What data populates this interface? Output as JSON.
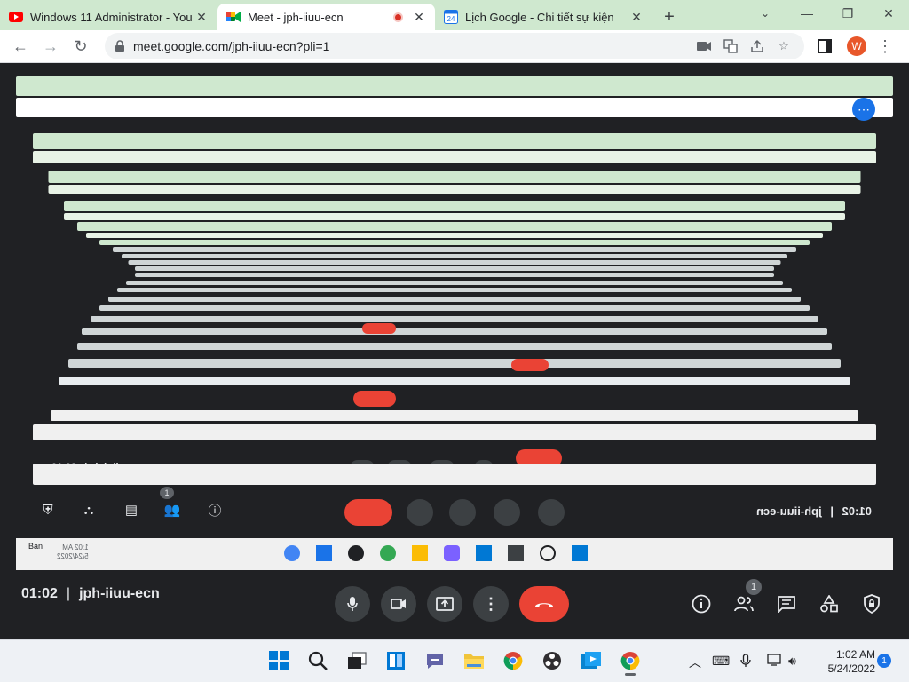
{
  "browser": {
    "tabs": [
      {
        "title": "Windows 11 Administrator - You",
        "icon": "youtube-icon",
        "active": false
      },
      {
        "title": "Meet - jph-iiuu-ecn",
        "icon": "google-meet-icon",
        "active": true
      },
      {
        "title": "Lịch Google - Chi tiết sự kiện",
        "icon": "google-calendar-icon",
        "calendar_day": "24",
        "active": false
      }
    ],
    "new_tab_label": "+",
    "url": "meet.google.com/jph-iiuu-ecn?pli=1",
    "profile_initial": "W",
    "colors": {
      "tab_strip": "#cfe8cf",
      "profile": "#e8572a",
      "record": "#d93025"
    }
  },
  "meeting": {
    "time": "01:02",
    "code": "jph-iiuu-ecn",
    "participants_badge": "1",
    "colors": {
      "end_call": "#ea4335",
      "button_bg": "#3c4043",
      "bg": "#202124"
    }
  },
  "shared_screen": {
    "description_icons": [
      "info-icon",
      "people-icon",
      "chat-icon",
      "activities-icon",
      "host-controls-icon"
    ],
    "time": "01:02",
    "code": "jph-iiuu-ecn",
    "badge": "1",
    "taskbar_corner": "Bạn",
    "taskbar_clock": "1:02 AM",
    "taskbar_date": "5/24/2022"
  },
  "taskbar": {
    "clock_time": "1:02 AM",
    "clock_date": "5/24/2022",
    "notification_count": "1"
  }
}
